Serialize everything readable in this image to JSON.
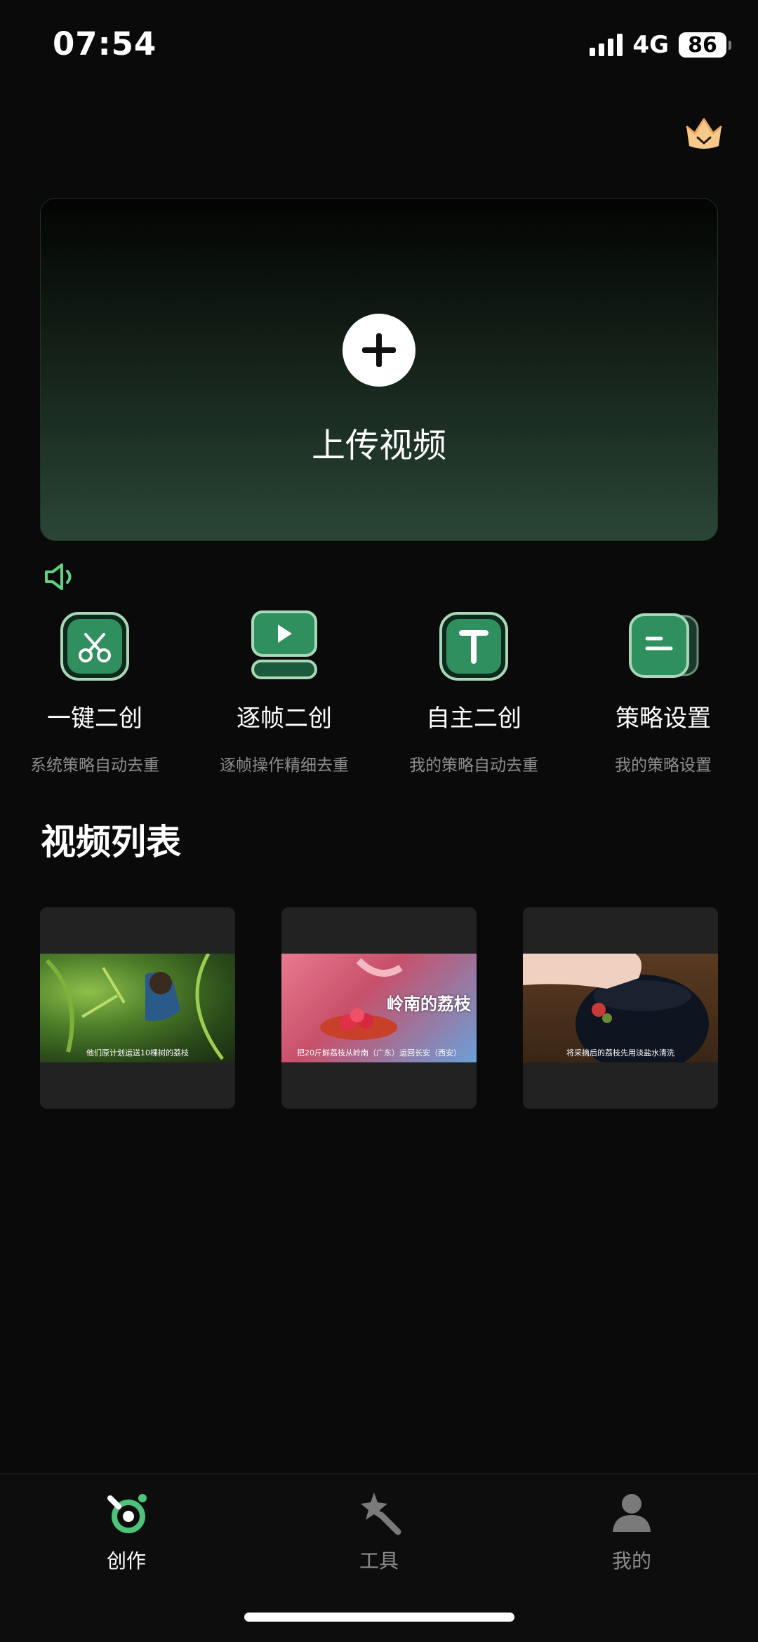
{
  "status_bar": {
    "time": "07:54",
    "network": "4G",
    "battery": "86"
  },
  "upload": {
    "label": "上传视频"
  },
  "features": [
    {
      "title": "一键二创",
      "subtitle": "系统策略自动去重",
      "icon": "scissors-icon"
    },
    {
      "title": "逐帧二创",
      "subtitle": "逐帧操作精细去重",
      "icon": "play-frame-icon"
    },
    {
      "title": "自主二创",
      "subtitle": "我的策略自动去重",
      "icon": "text-t-icon"
    },
    {
      "title": "策略设置",
      "subtitle": "我的策略设置",
      "icon": "strategy-cards-icon"
    }
  ],
  "video_list": {
    "title": "视频列表",
    "videos": [
      {
        "caption": "他们原计划运送10棵树的荔枝"
      },
      {
        "overlay_title": "岭南的荔枝",
        "caption": "把20斤鲜荔枝从岭南（广东）运回长安（西安）"
      },
      {
        "caption": "将采摘后的荔枝先用淡盐水清洗"
      }
    ]
  },
  "bottom_nav": {
    "items": [
      {
        "label": "创作",
        "active": true
      },
      {
        "label": "工具",
        "active": false
      },
      {
        "label": "我的",
        "active": false
      }
    ]
  },
  "colors": {
    "accent_green": "#4fc27a",
    "background": "#0a0a0a",
    "inactive": "#8c8c8c"
  }
}
